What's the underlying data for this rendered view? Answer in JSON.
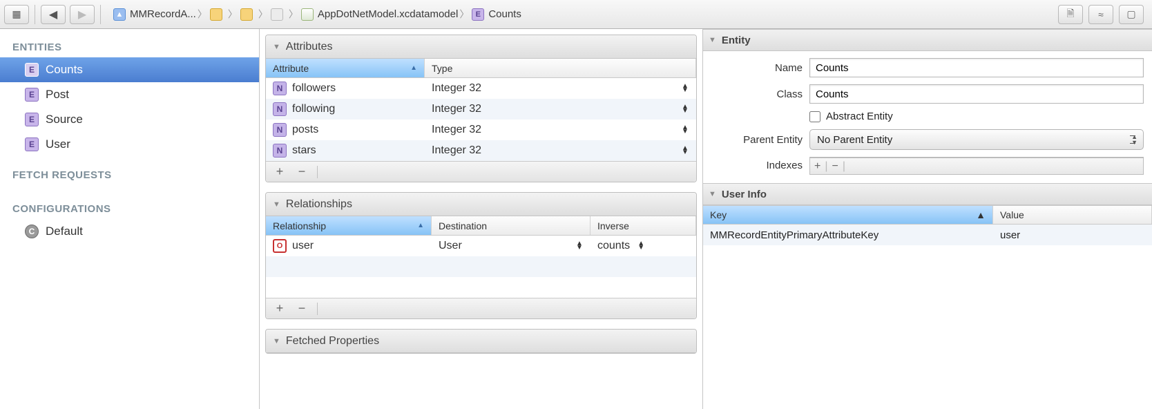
{
  "toolbar": {
    "breadcrumb": [
      {
        "icon": "proj",
        "label": "MMRecordA..."
      },
      {
        "icon": "folder",
        "label": ""
      },
      {
        "icon": "folder2",
        "label": ""
      },
      {
        "icon": "file",
        "label": ""
      },
      {
        "icon": "model",
        "label": "AppDotNetModel.xcdatamodel"
      },
      {
        "icon": "entity",
        "label": "Counts"
      }
    ]
  },
  "sidebar": {
    "headings": {
      "entities": "ENTITIES",
      "fetch": "FETCH REQUESTS",
      "config": "CONFIGURATIONS"
    },
    "entities": [
      {
        "label": "Counts",
        "selected": true
      },
      {
        "label": "Post",
        "selected": false
      },
      {
        "label": "Source",
        "selected": false
      },
      {
        "label": "User",
        "selected": false
      }
    ],
    "configurations": [
      {
        "label": "Default"
      }
    ]
  },
  "editor": {
    "attributes": {
      "title": "Attributes",
      "columns": {
        "c1": "Attribute",
        "c2": "Type"
      },
      "rows": [
        {
          "name": "followers",
          "type": "Integer 32"
        },
        {
          "name": "following",
          "type": "Integer 32"
        },
        {
          "name": "posts",
          "type": "Integer 32"
        },
        {
          "name": "stars",
          "type": "Integer 32"
        }
      ]
    },
    "relationships": {
      "title": "Relationships",
      "columns": {
        "c1": "Relationship",
        "c2": "Destination",
        "c3": "Inverse"
      },
      "rows": [
        {
          "name": "user",
          "destination": "User",
          "inverse": "counts"
        }
      ]
    },
    "fetched": {
      "title": "Fetched Properties"
    }
  },
  "inspector": {
    "entity": {
      "title": "Entity",
      "name_label": "Name",
      "name_value": "Counts",
      "class_label": "Class",
      "class_value": "Counts",
      "abstract_label": "Abstract Entity",
      "parent_label": "Parent Entity",
      "parent_value": "No Parent Entity",
      "indexes_label": "Indexes"
    },
    "userinfo": {
      "title": "User Info",
      "columns": {
        "key": "Key",
        "value": "Value"
      },
      "rows": [
        {
          "key": "MMRecordEntityPrimaryAttributeKey",
          "value": "user"
        }
      ]
    }
  }
}
